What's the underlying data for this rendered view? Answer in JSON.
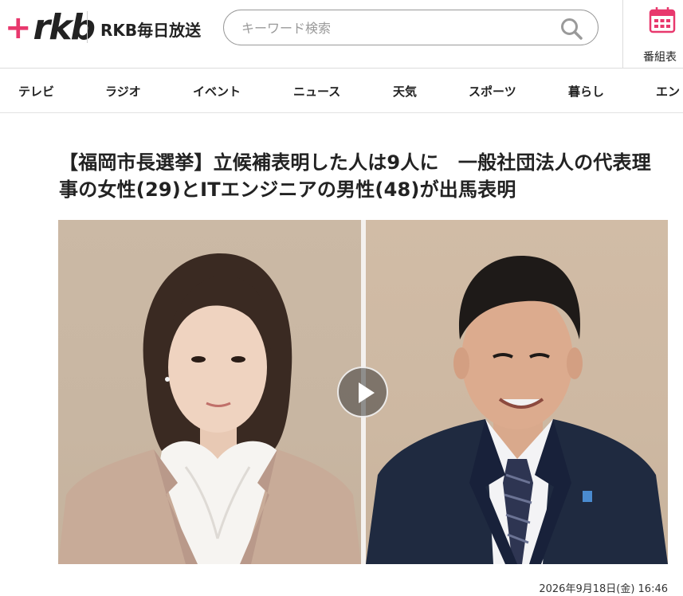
{
  "header": {
    "logo_plus": "+",
    "logo_text": "rkb",
    "station_name": "RKB毎日放送",
    "search_placeholder": "キーワード検索",
    "schedule_label": "番組表"
  },
  "nav": {
    "items": [
      "テレビ",
      "ラジオ",
      "イベント",
      "ニュース",
      "天気",
      "スポーツ",
      "暮らし",
      "エン"
    ]
  },
  "article": {
    "title": "【福岡市長選挙】立候補表明した人は9人に　一般社団法人の代表理事の女性(29)とITエンジニアの男性(48)が出馬表明",
    "date": "2026年9月18日(金) 16:46"
  },
  "colors": {
    "brand_pink": "#e8386d",
    "text": "#222222",
    "border": "#dcdcdc"
  },
  "icons": {
    "search": "search-icon",
    "schedule": "calendar-icon",
    "play": "play-icon"
  }
}
